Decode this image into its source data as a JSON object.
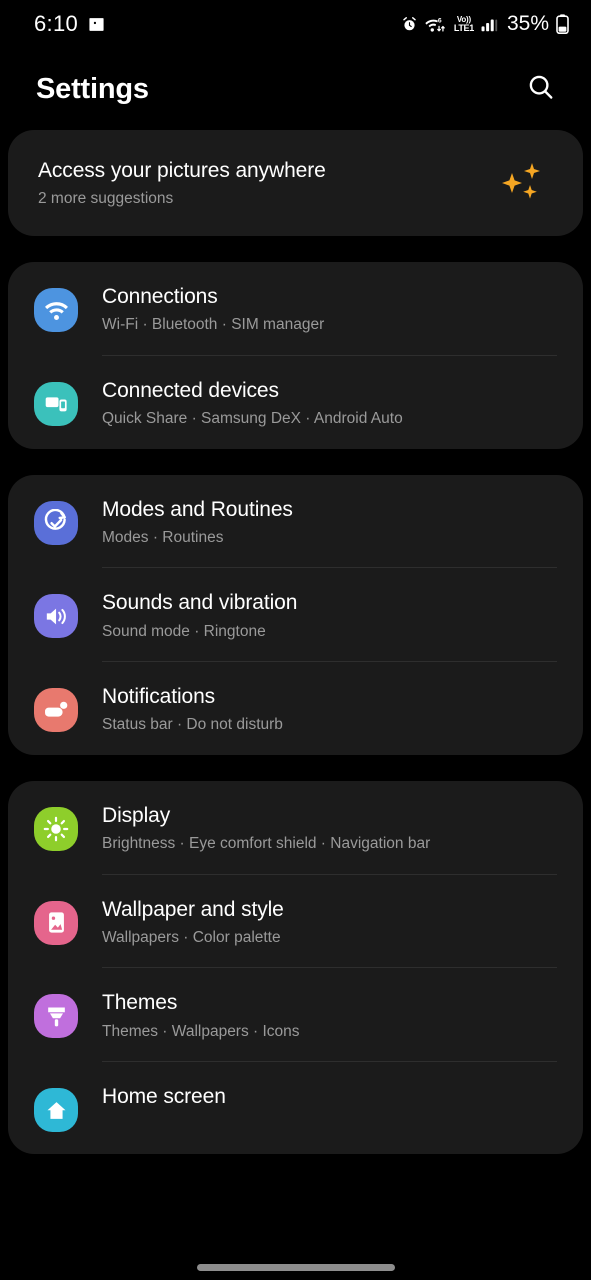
{
  "statusbar": {
    "time": "6:10",
    "left_icons": [
      "image-icon"
    ],
    "right_icons": [
      "alarm-icon",
      "wifi-6-icon",
      "volte-icon",
      "signal-bars-icon",
      "battery-icon"
    ],
    "wifi_generation": "6",
    "volte_line1": "Vo))",
    "volte_line2": "LTE1",
    "battery_percent": "35%"
  },
  "header": {
    "title": "Settings",
    "search_icon": "search-icon"
  },
  "suggestion": {
    "title": "Access your pictures anywhere",
    "subtitle": "2 more suggestions",
    "icon": "sparkles-icon",
    "icon_color": "#f5a623"
  },
  "groups": [
    {
      "items": [
        {
          "title": "Connections",
          "subtitle": "Wi-Fi  ·  Bluetooth  ·  SIM manager",
          "icon": "wifi-icon",
          "icon_color": "#4d94e0"
        },
        {
          "title": "Connected devices",
          "subtitle": "Quick Share  ·  Samsung DeX  ·  Android Auto",
          "icon": "connected-devices-icon",
          "icon_color": "#3bc1bb"
        }
      ]
    },
    {
      "items": [
        {
          "title": "Modes and Routines",
          "subtitle": "Modes  ·  Routines",
          "icon": "check-circle-icon",
          "icon_color": "#5a6fd8"
        },
        {
          "title": "Sounds and vibration",
          "subtitle": "Sound mode  ·  Ringtone",
          "icon": "speaker-icon",
          "icon_color": "#7b76e3"
        },
        {
          "title": "Notifications",
          "subtitle": "Status bar  ·  Do not disturb",
          "icon": "notification-bubble-icon",
          "icon_color": "#e8796e"
        }
      ]
    },
    {
      "items": [
        {
          "title": "Display",
          "subtitle": "Brightness  ·  Eye comfort shield  ·  Navigation bar",
          "icon": "brightness-icon",
          "icon_color": "#8ece2b"
        },
        {
          "title": "Wallpaper and style",
          "subtitle": "Wallpapers  ·  Color palette",
          "icon": "picture-icon",
          "icon_color": "#e5658c"
        },
        {
          "title": "Themes",
          "subtitle": "Themes  ·  Wallpapers  ·  Icons",
          "icon": "paintbrush-icon",
          "icon_color": "#c06fdd"
        },
        {
          "title": "Home screen",
          "subtitle": "",
          "icon": "home-screen-icon",
          "icon_color": "#2eb8d6"
        }
      ]
    }
  ],
  "navigation": {
    "gesture_bar": "gesture-bar"
  }
}
